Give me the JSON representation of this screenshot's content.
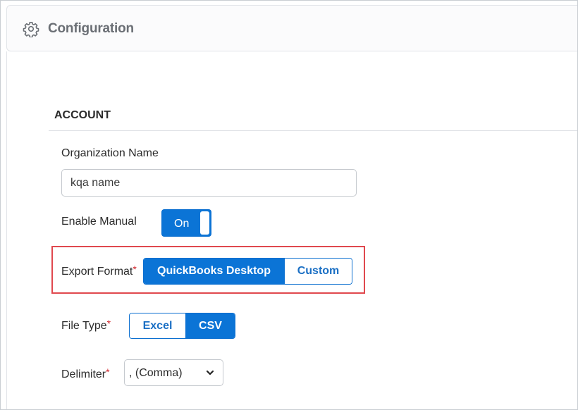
{
  "header": {
    "title": "Configuration",
    "icon": "gear-icon"
  },
  "account": {
    "section_title": "ACCOUNT",
    "organization_name": {
      "label": "Organization Name",
      "value": "kqa name"
    },
    "enable_manual": {
      "label": "Enable Manual",
      "state": "On"
    },
    "export_format": {
      "label": "Export Format",
      "required_mark": "*",
      "options": [
        "QuickBooks Desktop",
        "Custom"
      ],
      "selected": "QuickBooks Desktop"
    },
    "file_type": {
      "label": "File Type",
      "required_mark": "*",
      "options": [
        "Excel",
        "CSV"
      ],
      "selected": "CSV"
    },
    "delimiter": {
      "label": "Delimiter",
      "required_mark": "*",
      "value": ", (Comma)"
    }
  },
  "colors": {
    "accent": "#0b74d6",
    "highlight_border": "#e0484e",
    "required": "#d0262d"
  }
}
